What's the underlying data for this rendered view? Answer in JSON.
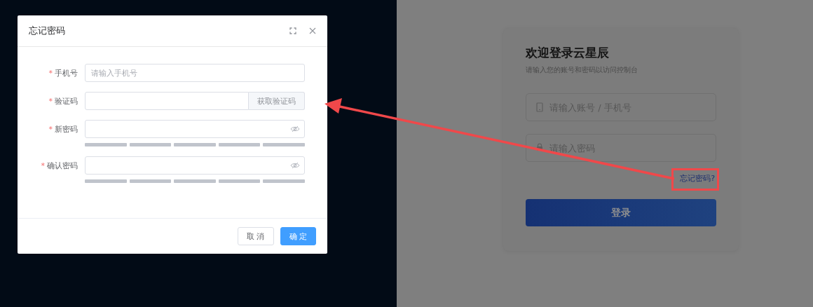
{
  "dialog": {
    "title": "忘记密码",
    "fields": [
      {
        "kind": "text",
        "mark": "*",
        "label": "手机号",
        "placeholder": "请输入手机号"
      },
      {
        "kind": "code",
        "mark": "*",
        "label": "验证码",
        "button": "获取验证码"
      },
      {
        "kind": "password",
        "mark": "*",
        "label": "新密码"
      },
      {
        "kind": "password",
        "mark": "*",
        "label": "确认密码"
      }
    ],
    "buttons": [
      {
        "label": "取 消",
        "primary": false
      },
      {
        "label": "确 定",
        "primary": true
      }
    ]
  },
  "login": {
    "title": "欢迎登录云星辰",
    "subtitle": "请输入您的账号和密码以访问控制台",
    "fields": [
      {
        "kind": "phone",
        "placeholder": "请输入账号 / 手机号"
      },
      {
        "kind": "lock",
        "placeholder": "请输入密码"
      }
    ],
    "forgot_link": "忘记密码?",
    "submit": "登录"
  }
}
